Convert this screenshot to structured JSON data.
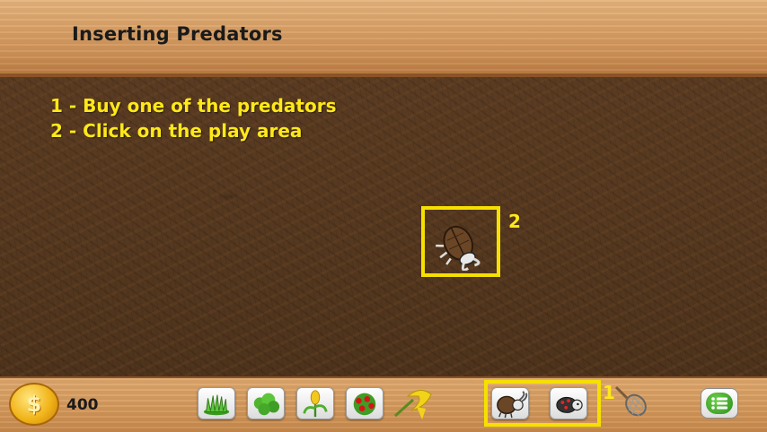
{
  "header": {
    "title": "Inserting Predators"
  },
  "instructions": {
    "step1": "1 - Buy one of the predators",
    "step2": "2 - Click on the play area"
  },
  "highlights": {
    "play_area_label": "2",
    "shop_label": "1"
  },
  "coins": {
    "count": "400",
    "icon": "coin-icon"
  },
  "toolbar": {
    "plants": [
      {
        "name": "grass",
        "icon": "grass-icon"
      },
      {
        "name": "shrub",
        "icon": "shrub-icon"
      },
      {
        "name": "corn",
        "icon": "corn-icon"
      },
      {
        "name": "berry-bush",
        "icon": "berry-icon"
      }
    ],
    "tools": [
      "banana-sickle-icon"
    ],
    "predators": [
      {
        "name": "stag-beetle",
        "icon": "stag-beetle-icon"
      },
      {
        "name": "ladybug",
        "icon": "ladybug-icon"
      }
    ],
    "net": "net-icon",
    "menu": "menu-icon"
  },
  "colors": {
    "highlight": "#f5e000",
    "instruction_text": "#ffe81a",
    "soil": "#55381f",
    "wood": "#d9a066"
  }
}
